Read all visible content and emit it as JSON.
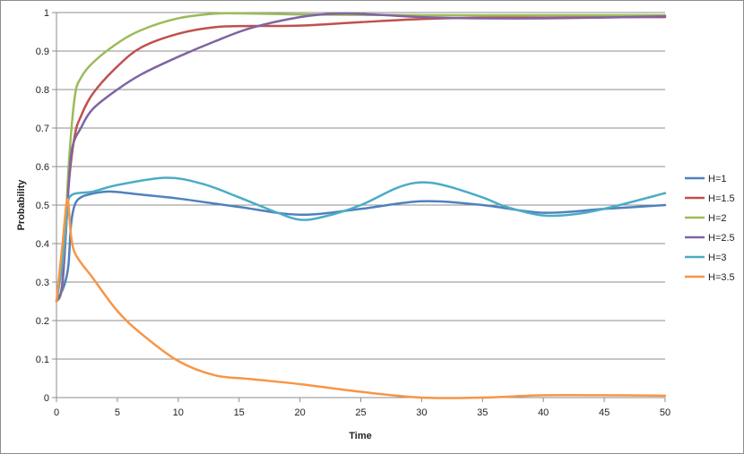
{
  "chart_data": {
    "type": "line",
    "title": "",
    "xlabel": "Time",
    "ylabel": "Probability",
    "xlim": [
      0,
      50
    ],
    "ylim": [
      0,
      1
    ],
    "xticks": [
      0,
      5,
      10,
      15,
      20,
      25,
      30,
      35,
      40,
      45,
      50
    ],
    "yticks": [
      0,
      0.1,
      0.2,
      0.3,
      0.4,
      0.5,
      0.6,
      0.7,
      0.8,
      0.9,
      1
    ],
    "grid": "horizontal",
    "legend_position": "right",
    "series": [
      {
        "name": "H=1",
        "color": "#4f81bd",
        "points": [
          [
            0,
            0.25
          ],
          [
            0.5,
            0.28
          ],
          [
            0.8,
            0.31
          ],
          [
            1,
            0.35
          ],
          [
            1.2,
            0.45
          ],
          [
            1.5,
            0.5
          ],
          [
            2,
            0.52
          ],
          [
            3,
            0.53
          ],
          [
            4.5,
            0.535
          ],
          [
            7,
            0.527
          ],
          [
            10,
            0.517
          ],
          [
            15,
            0.495
          ],
          [
            20,
            0.475
          ],
          [
            25,
            0.49
          ],
          [
            30,
            0.51
          ],
          [
            35,
            0.5
          ],
          [
            40,
            0.48
          ],
          [
            45,
            0.49
          ],
          [
            50,
            0.5
          ]
        ]
      },
      {
        "name": "H=1.5",
        "color": "#c0504d",
        "points": [
          [
            0,
            0.25
          ],
          [
            0.5,
            0.3
          ],
          [
            1,
            0.55
          ],
          [
            1.5,
            0.68
          ],
          [
            2,
            0.73
          ],
          [
            3,
            0.79
          ],
          [
            5,
            0.86
          ],
          [
            7,
            0.91
          ],
          [
            10,
            0.945
          ],
          [
            13,
            0.962
          ],
          [
            16,
            0.965
          ],
          [
            20,
            0.966
          ],
          [
            25,
            0.975
          ],
          [
            30,
            0.983
          ],
          [
            35,
            0.987
          ],
          [
            40,
            0.987
          ],
          [
            45,
            0.988
          ],
          [
            50,
            0.988
          ]
        ]
      },
      {
        "name": "H=2",
        "color": "#9bbb59",
        "points": [
          [
            0,
            0.25
          ],
          [
            0.5,
            0.3
          ],
          [
            1,
            0.6
          ],
          [
            1.5,
            0.78
          ],
          [
            2,
            0.83
          ],
          [
            3,
            0.87
          ],
          [
            5,
            0.92
          ],
          [
            7,
            0.955
          ],
          [
            10,
            0.985
          ],
          [
            13,
            0.997
          ],
          [
            15,
            0.998
          ],
          [
            20,
            0.995
          ],
          [
            30,
            0.993
          ],
          [
            40,
            0.993
          ],
          [
            50,
            0.993
          ]
        ]
      },
      {
        "name": "H=2.5",
        "color": "#8064a2",
        "points": [
          [
            0,
            0.25
          ],
          [
            0.5,
            0.3
          ],
          [
            1,
            0.55
          ],
          [
            1.3,
            0.65
          ],
          [
            2,
            0.7
          ],
          [
            3,
            0.75
          ],
          [
            5,
            0.8
          ],
          [
            7,
            0.84
          ],
          [
            10,
            0.885
          ],
          [
            13,
            0.925
          ],
          [
            16,
            0.96
          ],
          [
            20,
            0.988
          ],
          [
            23,
            0.997
          ],
          [
            26,
            0.995
          ],
          [
            30,
            0.988
          ],
          [
            35,
            0.985
          ],
          [
            40,
            0.985
          ],
          [
            45,
            0.987
          ],
          [
            50,
            0.99
          ]
        ]
      },
      {
        "name": "H=3",
        "color": "#4bacc6",
        "points": [
          [
            0,
            0.25
          ],
          [
            0.5,
            0.35
          ],
          [
            0.9,
            0.48
          ],
          [
            1.2,
            0.525
          ],
          [
            3,
            0.535
          ],
          [
            5,
            0.552
          ],
          [
            9,
            0.571
          ],
          [
            12,
            0.555
          ],
          [
            15,
            0.52
          ],
          [
            18,
            0.482
          ],
          [
            20,
            0.462
          ],
          [
            22,
            0.47
          ],
          [
            25,
            0.5
          ],
          [
            28,
            0.545
          ],
          [
            30,
            0.559
          ],
          [
            32,
            0.55
          ],
          [
            35,
            0.52
          ],
          [
            37,
            0.495
          ],
          [
            40,
            0.473
          ],
          [
            43,
            0.478
          ],
          [
            46,
            0.498
          ],
          [
            50,
            0.531
          ]
        ]
      },
      {
        "name": "H=3.5",
        "color": "#f79646",
        "points": [
          [
            0,
            0.25
          ],
          [
            0.5,
            0.4
          ],
          [
            0.9,
            0.515
          ],
          [
            1.2,
            0.42
          ],
          [
            1.6,
            0.37
          ],
          [
            3,
            0.31
          ],
          [
            5,
            0.225
          ],
          [
            7,
            0.165
          ],
          [
            10,
            0.095
          ],
          [
            13,
            0.058
          ],
          [
            16,
            0.048
          ],
          [
            20,
            0.035
          ],
          [
            25,
            0.015
          ],
          [
            30,
            0.0
          ],
          [
            35,
            0.0
          ],
          [
            40,
            0.006
          ],
          [
            45,
            0.006
          ],
          [
            50,
            0.005
          ]
        ]
      }
    ]
  }
}
